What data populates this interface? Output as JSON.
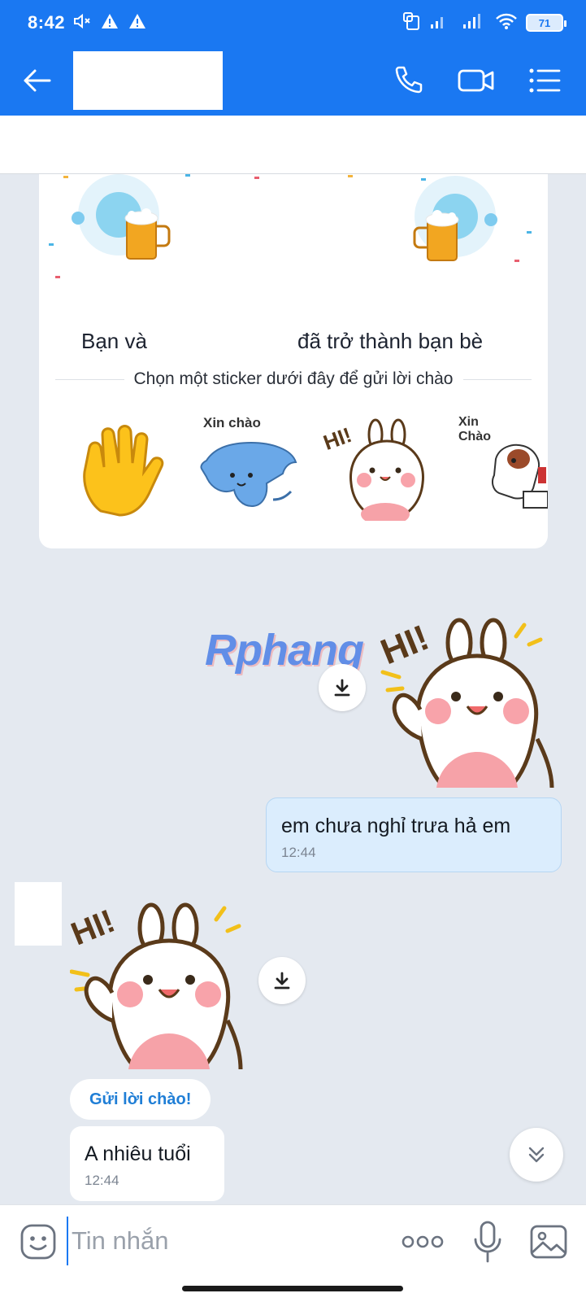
{
  "status_bar": {
    "time": "8:42",
    "battery": "71"
  },
  "header": {
    "contact_name": ""
  },
  "friend_card": {
    "title_part1": "Bạn và",
    "title_part2": "đã trở thành bạn bè",
    "subtitle": "Chọn một sticker dưới đây để gửi lời chào",
    "stickers": [
      {
        "name": "wave-hand-sticker",
        "caption": ""
      },
      {
        "name": "cat-xin-chao-sticker",
        "caption": "Xin chào"
      },
      {
        "name": "bunny-hi-sticker",
        "caption": "HI!"
      },
      {
        "name": "dog-xin-chao-sticker",
        "caption": "Xin Chào"
      }
    ]
  },
  "watermark": "Rphang",
  "sticker_caption": "HI!",
  "messages": {
    "outgoing_text": "em chưa nghỉ trưa hả em",
    "outgoing_time": "12:44",
    "greeting_button": "Gửi lời chào!",
    "incoming_text": "A nhiêu tuổi",
    "incoming_time": "12:44"
  },
  "input": {
    "placeholder": "Tin nhắn"
  },
  "colors": {
    "primary": "#1a78f2",
    "bubble_out": "#dbedfd",
    "background": "#e4e9f0"
  }
}
